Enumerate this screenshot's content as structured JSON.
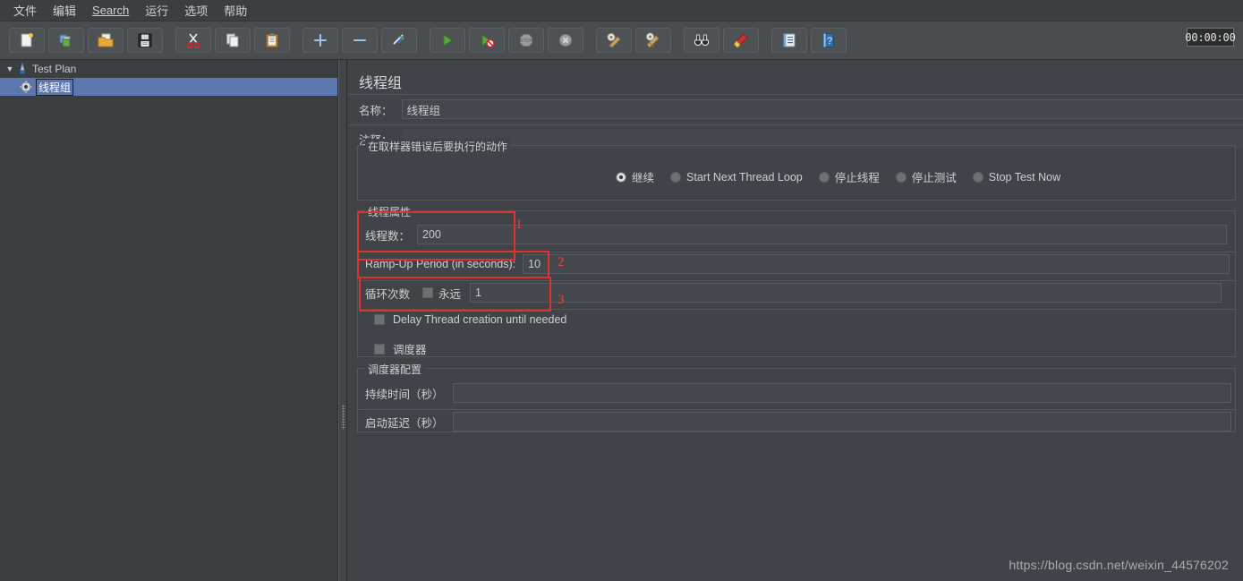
{
  "window": {
    "timer": "00:00:00"
  },
  "menubar": {
    "items": [
      {
        "label": "文件",
        "mnemonic": ""
      },
      {
        "label": "编辑",
        "mnemonic": ""
      },
      {
        "label": "Search",
        "mnemonic": "S"
      },
      {
        "label": "运行",
        "mnemonic": ""
      },
      {
        "label": "选项",
        "mnemonic": ""
      },
      {
        "label": "帮助",
        "mnemonic": ""
      }
    ]
  },
  "toolbar": {
    "buttons": [
      {
        "name": "new-icon",
        "title": "新建"
      },
      {
        "name": "templates-icon",
        "title": "模板"
      },
      {
        "name": "open-folder-icon",
        "title": "打开"
      },
      {
        "name": "save-icon",
        "title": "保存"
      },
      {
        "name": "cut-scissors-icon",
        "title": "剪切"
      },
      {
        "name": "copy-icon",
        "title": "复制"
      },
      {
        "name": "paste-clipboard-icon",
        "title": "粘贴"
      },
      {
        "name": "plus-icon",
        "title": "展开全部"
      },
      {
        "name": "minus-icon",
        "title": "折叠全部"
      },
      {
        "name": "toggle-icon",
        "title": "切换"
      },
      {
        "name": "start-play-icon",
        "title": "启动"
      },
      {
        "name": "start-no-pause-icon",
        "title": "无超时启动"
      },
      {
        "name": "stop-icon",
        "title": "停止"
      },
      {
        "name": "shutdown-icon",
        "title": "关闭"
      },
      {
        "name": "clear-icon",
        "title": "清除"
      },
      {
        "name": "clear-all-icon",
        "title": "清除全部"
      },
      {
        "name": "search-binoculars-icon",
        "title": "查找"
      },
      {
        "name": "reset-search-icon",
        "title": "重置查找"
      },
      {
        "name": "function-helper-icon",
        "title": "函数助手"
      },
      {
        "name": "help-icon",
        "title": "帮助"
      }
    ]
  },
  "tree": {
    "root": {
      "label": "Test Plan",
      "icon": "test-plan-icon",
      "expanded": true
    },
    "children": [
      {
        "label": "线程组",
        "icon": "thread-group-gear-icon",
        "selected": true
      }
    ]
  },
  "main": {
    "title": "线程组",
    "name_label": "名称：",
    "name_value": "线程组",
    "comment_label": "注释：",
    "comment_value": "",
    "error_action": {
      "title": "在取样器错误后要执行的动作",
      "options": [
        {
          "label": "继续",
          "selected": true
        },
        {
          "label": "Start Next Thread Loop",
          "selected": false
        },
        {
          "label": "停止线程",
          "selected": false
        },
        {
          "label": "停止测试",
          "selected": false
        },
        {
          "label": "Stop Test Now",
          "selected": false
        }
      ]
    },
    "thread_properties": {
      "title": "线程属性",
      "threads_label": "线程数：",
      "threads_value": "200",
      "rampup_label": "Ramp-Up Period (in seconds):",
      "rampup_value": "10",
      "loop_label": "循环次数",
      "forever_label": "永远",
      "forever_checked": false,
      "loop_value": "1",
      "delay_creation_label": "Delay Thread creation until needed",
      "delay_creation_checked": false,
      "scheduler_label": "调度器",
      "scheduler_checked": false
    },
    "scheduler_config": {
      "title": "调度器配置",
      "duration_label": "持续时间（秒）",
      "duration_value": "",
      "startup_delay_label": "启动延迟（秒）",
      "startup_delay_value": ""
    },
    "annotations": [
      {
        "number": "1"
      },
      {
        "number": "2"
      },
      {
        "number": "3"
      }
    ]
  },
  "watermark": "https://blog.csdn.net/weixin_44576202"
}
